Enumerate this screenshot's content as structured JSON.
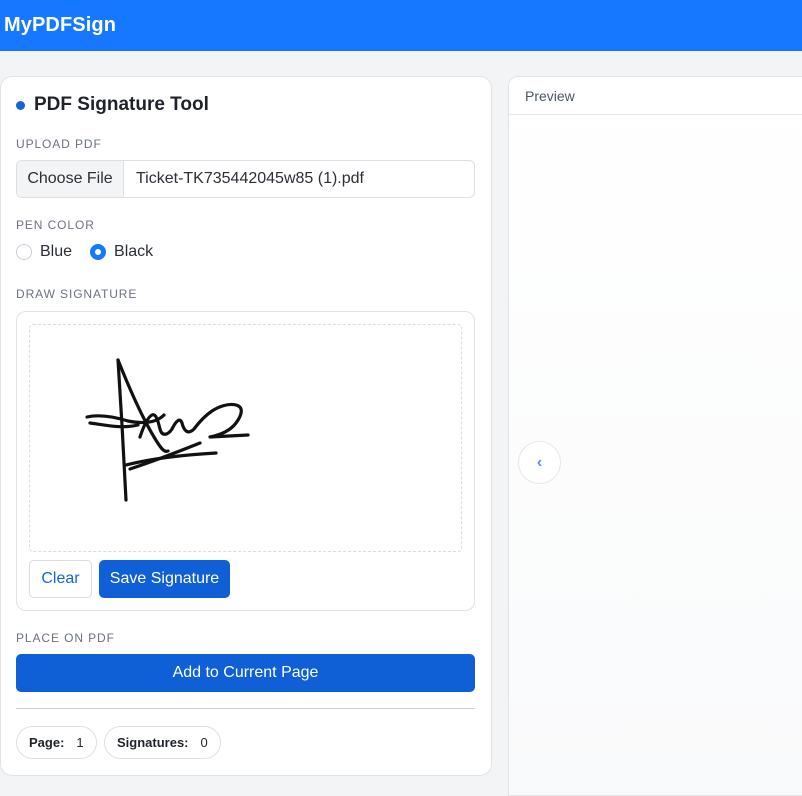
{
  "app": {
    "brand": "MyPDFSign"
  },
  "panel": {
    "title": "PDF Signature Tool",
    "upload_label": "UPLOAD PDF",
    "choose_file_label": "Choose File",
    "file_name": "Ticket-TK735442045w85 (1).pdf",
    "pen_color_label": "PEN COLOR",
    "pen_colors": [
      {
        "label": "Blue",
        "checked": false
      },
      {
        "label": "Black",
        "checked": true
      }
    ],
    "draw_signature_label": "DRAW SIGNATURE",
    "clear_label": "Clear",
    "save_signature_label": "Save Signature",
    "place_label": "PLACE ON PDF",
    "add_to_page_label": "Add to Current Page",
    "page_key": "Page:",
    "page_value": "1",
    "signatures_key": "Signatures:",
    "signatures_value": "0"
  },
  "preview": {
    "header": "Preview",
    "prev_icon": "‹"
  },
  "colors": {
    "topbar": "#1677ff",
    "primary_button": "#0f5fd6",
    "ink": "#111111"
  },
  "icons": [
    "chevron-left-icon",
    "dot-icon"
  ]
}
